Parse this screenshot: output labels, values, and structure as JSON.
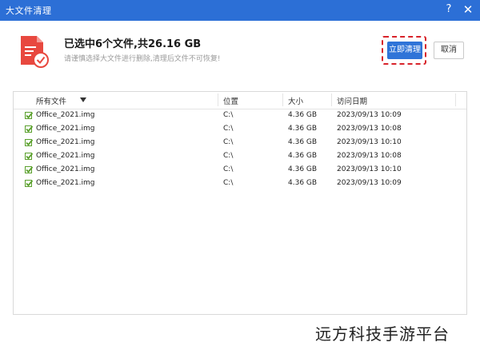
{
  "window": {
    "title": "大文件清理",
    "help_glyph": "?",
    "close_glyph": "✕"
  },
  "summary": {
    "headline": "已选中6个文件,共26.16 GB",
    "subtext": "请谨慎选择大文件进行删除,清理后文件不可恢复!",
    "icon": "red-file-check-icon"
  },
  "buttons": {
    "clean_now": "立即清理",
    "cancel": "取消"
  },
  "table": {
    "columns": [
      "所有文件",
      "位置",
      "大小",
      "访问日期"
    ],
    "rows": [
      {
        "checked": true,
        "name": "Office_2021.img",
        "location": "C:\\",
        "size": "4.36 GB",
        "date": "2023/09/13 10:09"
      },
      {
        "checked": true,
        "name": "Office_2021.img",
        "location": "C:\\",
        "size": "4.36 GB",
        "date": "2023/09/13 10:08"
      },
      {
        "checked": true,
        "name": "Office_2021.img",
        "location": "C:\\",
        "size": "4.36 GB",
        "date": "2023/09/13 10:10"
      },
      {
        "checked": true,
        "name": "Office_2021.img",
        "location": "C:\\",
        "size": "4.36 GB",
        "date": "2023/09/13 10:08"
      },
      {
        "checked": true,
        "name": "Office_2021.img",
        "location": "C:\\",
        "size": "4.36 GB",
        "date": "2023/09/13 10:10"
      },
      {
        "checked": true,
        "name": "Office_2021.img",
        "location": "C:\\",
        "size": "4.36 GB",
        "date": "2023/09/13 10:09"
      }
    ]
  },
  "watermark": "远方科技手游平台",
  "colors": {
    "titlebar": "#2c6fd6",
    "primary": "#2f74d8",
    "highlight": "#d8232a",
    "check": "#5aa02c",
    "file_icon": "#e8483f"
  }
}
